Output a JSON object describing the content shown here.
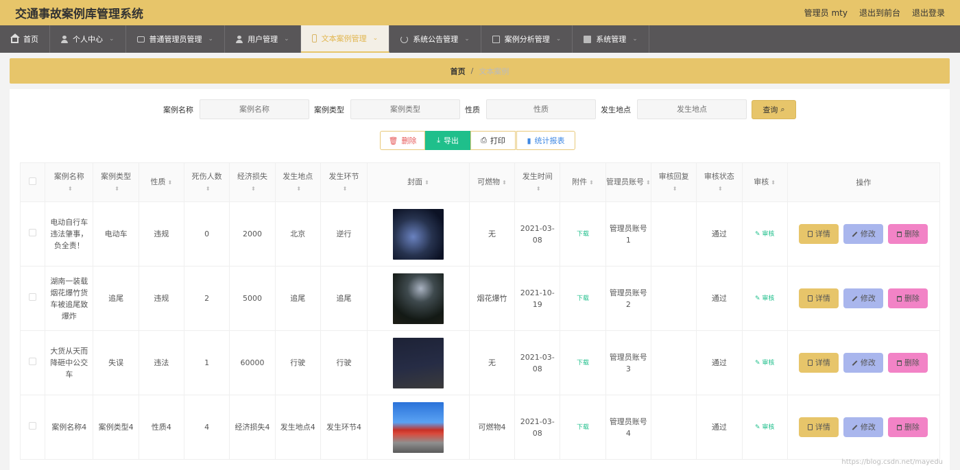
{
  "header": {
    "title": "交通事故案例库管理系统",
    "user": "管理员 mty",
    "back_front": "退出到前台",
    "logout": "退出登录"
  },
  "nav": [
    {
      "label": "首页",
      "icon": "home-icon",
      "active": false,
      "caret": false
    },
    {
      "label": "个人中心",
      "icon": "user-icon",
      "active": false,
      "caret": true
    },
    {
      "label": "普通管理员管理",
      "icon": "chat-icon",
      "active": false,
      "caret": true
    },
    {
      "label": "用户管理",
      "icon": "user-icon",
      "active": false,
      "caret": true
    },
    {
      "label": "文本案例管理",
      "icon": "phone-icon",
      "active": true,
      "caret": true
    },
    {
      "label": "系统公告管理",
      "icon": "power-icon",
      "active": false,
      "caret": true
    },
    {
      "label": "案例分析管理",
      "icon": "copy-icon",
      "active": false,
      "caret": true
    },
    {
      "label": "系统管理",
      "icon": "check-icon",
      "active": false,
      "caret": true
    }
  ],
  "breadcrumb": {
    "home": "首页",
    "sep": "/",
    "current": "文本案例"
  },
  "search": {
    "name_label": "案例名称",
    "name_placeholder": "案例名称",
    "type_label": "案例类型",
    "type_placeholder": "案例类型",
    "nature_label": "性质",
    "nature_placeholder": "性质",
    "place_label": "发生地点",
    "place_placeholder": "发生地点",
    "query_label": "查询"
  },
  "actions": {
    "delete": "删除",
    "export": "导出",
    "print": "打印",
    "stats": "统计报表"
  },
  "table": {
    "headers": [
      "案例名称",
      "案例类型",
      "性质",
      "死伤人数",
      "经济损失",
      "发生地点",
      "发生环节",
      "封面",
      "可燃物",
      "发生时间",
      "附件",
      "管理员账号",
      "审核回复",
      "审核状态",
      "审核",
      "操作"
    ],
    "rows": [
      {
        "name": "电动自行车违法肇事，负全责！",
        "type": "电动车",
        "nature": "违规",
        "casualties": "0",
        "loss": "2000",
        "place": "北京",
        "stage": "逆行",
        "cover": "cover-photo-1",
        "combustible": "无",
        "time": "2021-03-08",
        "attachment": "下载",
        "admin": "管理员账号1",
        "reply": "",
        "status": "通过",
        "audit": "审核"
      },
      {
        "name": "湖南一装载烟花爆竹货车被追尾致爆炸",
        "type": "追尾",
        "nature": "违规",
        "casualties": "2",
        "loss": "5000",
        "place": "追尾",
        "stage": "追尾",
        "cover": "cover-photo-2",
        "combustible": "烟花爆竹",
        "time": "2021-10-19",
        "attachment": "下载",
        "admin": "管理员账号2",
        "reply": "",
        "status": "通过",
        "audit": "审核"
      },
      {
        "name": "大货从天而降砸中公交车",
        "type": "失误",
        "nature": "违法",
        "casualties": "1",
        "loss": "60000",
        "place": "行驶",
        "stage": "行驶",
        "cover": "cover-photo-3",
        "combustible": "无",
        "time": "2021-03-08",
        "attachment": "下载",
        "admin": "管理员账号3",
        "reply": "",
        "status": "通过",
        "audit": "审核"
      },
      {
        "name": "案例名称4",
        "type": "案例类型4",
        "nature": "性质4",
        "casualties": "4",
        "loss": "经济损失4",
        "place": "发生地点4",
        "stage": "发生环节4",
        "cover": "cover-photo-4",
        "combustible": "可燃物4",
        "time": "2021-03-08",
        "attachment": "下载",
        "admin": "管理员账号4",
        "reply": "",
        "status": "通过",
        "audit": "审核"
      }
    ],
    "ops": {
      "detail": "详情",
      "edit": "修改",
      "delete": "删除"
    }
  },
  "watermark": "https://blog.csdn.net/mayedu"
}
